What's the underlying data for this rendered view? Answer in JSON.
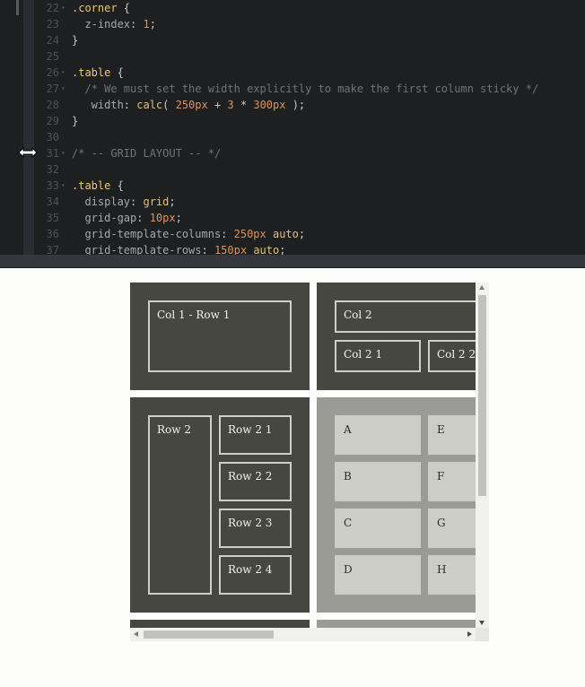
{
  "editor": {
    "lines": [
      {
        "num": "22",
        "fold": true,
        "tokens": [
          {
            "t": ".corner",
            "c": "t-sel"
          },
          {
            "t": " {",
            "c": "t-punc"
          }
        ]
      },
      {
        "num": "23",
        "fold": false,
        "tokens": [
          {
            "t": "  z-index",
            "c": "t-prop"
          },
          {
            "t": ": ",
            "c": "t-punc"
          },
          {
            "t": "1",
            "c": "t-num"
          },
          {
            "t": ";",
            "c": "t-punc"
          }
        ]
      },
      {
        "num": "24",
        "fold": false,
        "tokens": [
          {
            "t": "}",
            "c": "t-punc"
          }
        ]
      },
      {
        "num": "25",
        "fold": false,
        "tokens": []
      },
      {
        "num": "26",
        "fold": true,
        "tokens": [
          {
            "t": ".table",
            "c": "t-sel"
          },
          {
            "t": " {",
            "c": "t-punc"
          }
        ]
      },
      {
        "num": "27",
        "fold": true,
        "tokens": [
          {
            "t": "  /* We must set the width explicitly to make the first column sticky */",
            "c": "t-com"
          }
        ]
      },
      {
        "num": "28",
        "fold": false,
        "tokens": [
          {
            "t": "   width",
            "c": "t-prop"
          },
          {
            "t": ": ",
            "c": "t-punc"
          },
          {
            "t": "calc",
            "c": "t-kw"
          },
          {
            "t": "( ",
            "c": "t-punc"
          },
          {
            "t": "250px",
            "c": "t-num"
          },
          {
            "t": " + ",
            "c": "t-punc"
          },
          {
            "t": "3",
            "c": "t-num"
          },
          {
            "t": " * ",
            "c": "t-punc"
          },
          {
            "t": "300px",
            "c": "t-num"
          },
          {
            "t": " );",
            "c": "t-punc"
          }
        ]
      },
      {
        "num": "29",
        "fold": false,
        "tokens": [
          {
            "t": "}",
            "c": "t-punc"
          }
        ]
      },
      {
        "num": "30",
        "fold": false,
        "tokens": []
      },
      {
        "num": "31",
        "fold": true,
        "tokens": [
          {
            "t": "/* -- GRID LAYOUT -- */",
            "c": "t-com"
          }
        ]
      },
      {
        "num": "32",
        "fold": false,
        "tokens": []
      },
      {
        "num": "33",
        "fold": true,
        "tokens": [
          {
            "t": ".table",
            "c": "t-sel"
          },
          {
            "t": " {",
            "c": "t-punc"
          }
        ]
      },
      {
        "num": "34",
        "fold": false,
        "tokens": [
          {
            "t": "  display",
            "c": "t-prop"
          },
          {
            "t": ": ",
            "c": "t-punc"
          },
          {
            "t": "grid",
            "c": "t-kw"
          },
          {
            "t": ";",
            "c": "t-punc"
          }
        ]
      },
      {
        "num": "35",
        "fold": false,
        "tokens": [
          {
            "t": "  grid-gap",
            "c": "t-prop"
          },
          {
            "t": ": ",
            "c": "t-punc"
          },
          {
            "t": "10px",
            "c": "t-num"
          },
          {
            "t": ";",
            "c": "t-punc"
          }
        ]
      },
      {
        "num": "36",
        "fold": false,
        "tokens": [
          {
            "t": "  grid-template-columns",
            "c": "t-prop"
          },
          {
            "t": ": ",
            "c": "t-punc"
          },
          {
            "t": "250px",
            "c": "t-num"
          },
          {
            "t": " ",
            "c": "t-punc"
          },
          {
            "t": "auto",
            "c": "t-kw"
          },
          {
            "t": ";",
            "c": "t-punc"
          }
        ]
      },
      {
        "num": "37",
        "fold": false,
        "tokens": [
          {
            "t": "  grid-template-rows",
            "c": "t-prop"
          },
          {
            "t": ": ",
            "c": "t-punc"
          },
          {
            "t": "150px",
            "c": "t-num"
          },
          {
            "t": " ",
            "c": "t-punc"
          },
          {
            "t": "auto",
            "c": "t-kw"
          },
          {
            "t": ";",
            "c": "t-punc"
          }
        ]
      }
    ]
  },
  "preview": {
    "corner_cell": {
      "label": "Col 1 - Row 1"
    },
    "header_cell": {
      "col_label": "Col 2",
      "sub_cols": [
        "Col 2 1",
        "Col 2 2"
      ]
    },
    "row_header_cell": {
      "row_label": "Row 2",
      "sub_rows": [
        "Row 2 1",
        "Row 2 2",
        "Row 2 3",
        "Row 2 4"
      ]
    },
    "body_cell": {
      "col_a": [
        "A",
        "B",
        "C",
        "D"
      ],
      "col_b": [
        "E",
        "F",
        "G",
        "H"
      ]
    }
  },
  "icons": {
    "resize_cursor": "resize-horizontal-icon",
    "scroll_up": "arrow-up-icon",
    "scroll_down": "arrow-down-icon",
    "scroll_left": "arrow-left-icon",
    "scroll_right": "arrow-right-icon"
  },
  "colors": {
    "editor_bg": "#1d1f21",
    "selector": "#f0c674",
    "number": "#de935f",
    "comment": "#6f7479",
    "cell_dark": "#474742",
    "cell_light": "#9a9a96",
    "tile": "#cdcdc8"
  }
}
